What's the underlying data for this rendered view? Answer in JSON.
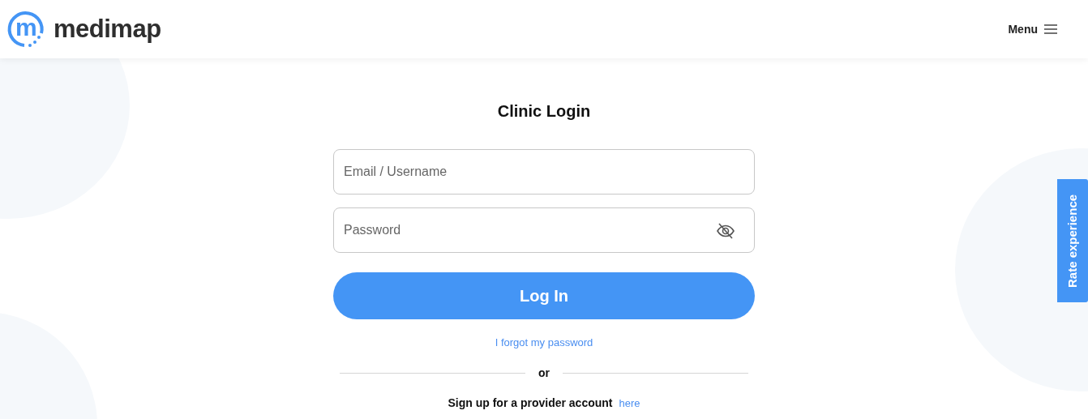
{
  "header": {
    "logo_mark": "m",
    "logo_text": "medimap",
    "menu_label": "Menu"
  },
  "login": {
    "title": "Clinic Login",
    "fields": [
      {
        "kind": "text",
        "placeholder": "Email / Username"
      },
      {
        "kind": "password",
        "placeholder": "Password",
        "reveal": false
      }
    ],
    "submit": "Log In",
    "forgot": "I forgot my password",
    "divider": "or",
    "signup_text": "Sign up for a provider account",
    "signup_link": "here"
  },
  "feedback_tab": "Rate experience"
}
